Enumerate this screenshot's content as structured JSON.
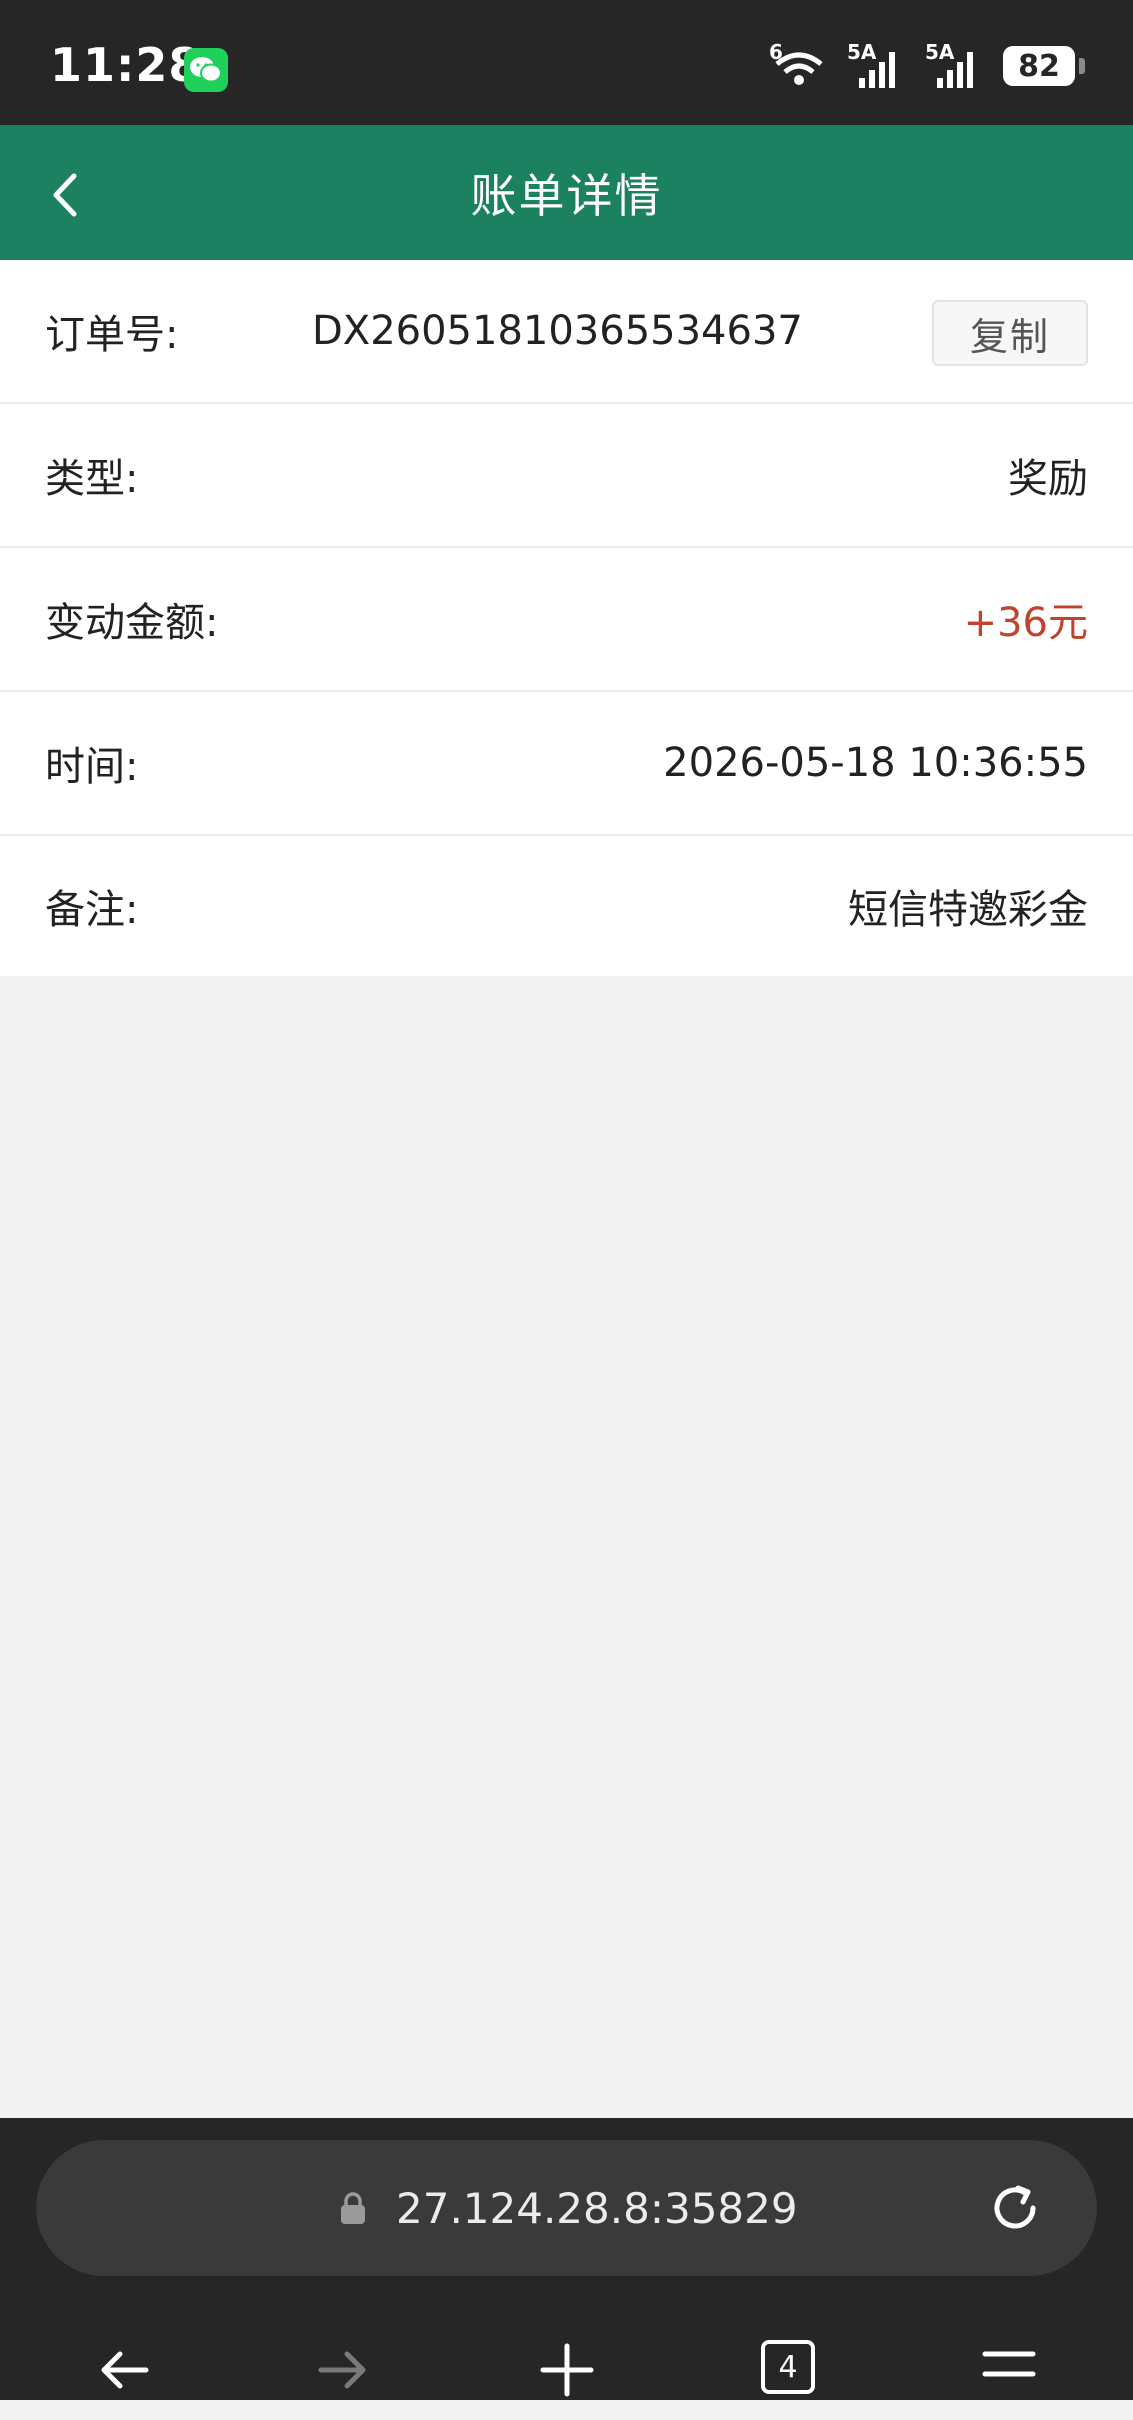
{
  "status_bar": {
    "time": "11:28",
    "network_1": "5A",
    "network_2": "5A",
    "wifi_label": "6",
    "battery": "82"
  },
  "header": {
    "title": "账单详情"
  },
  "details": {
    "order_label": "订单号:",
    "order_value": "DX26051810365534637",
    "copy_label": "复制",
    "type_label": "类型:",
    "type_value": "奖励",
    "amount_label": "变动金额:",
    "amount_value": "+36元",
    "time_label": "时间:",
    "time_value": "2026-05-18 10:36:55",
    "note_label": "备注:",
    "note_value": "短信特邀彩金"
  },
  "browser": {
    "url": "27.124.28.8:35829",
    "tab_count": "4"
  },
  "colors": {
    "header_bg": "#1b8160",
    "amount_color": "#c0432e",
    "page_bg": "#f2f2f2"
  }
}
